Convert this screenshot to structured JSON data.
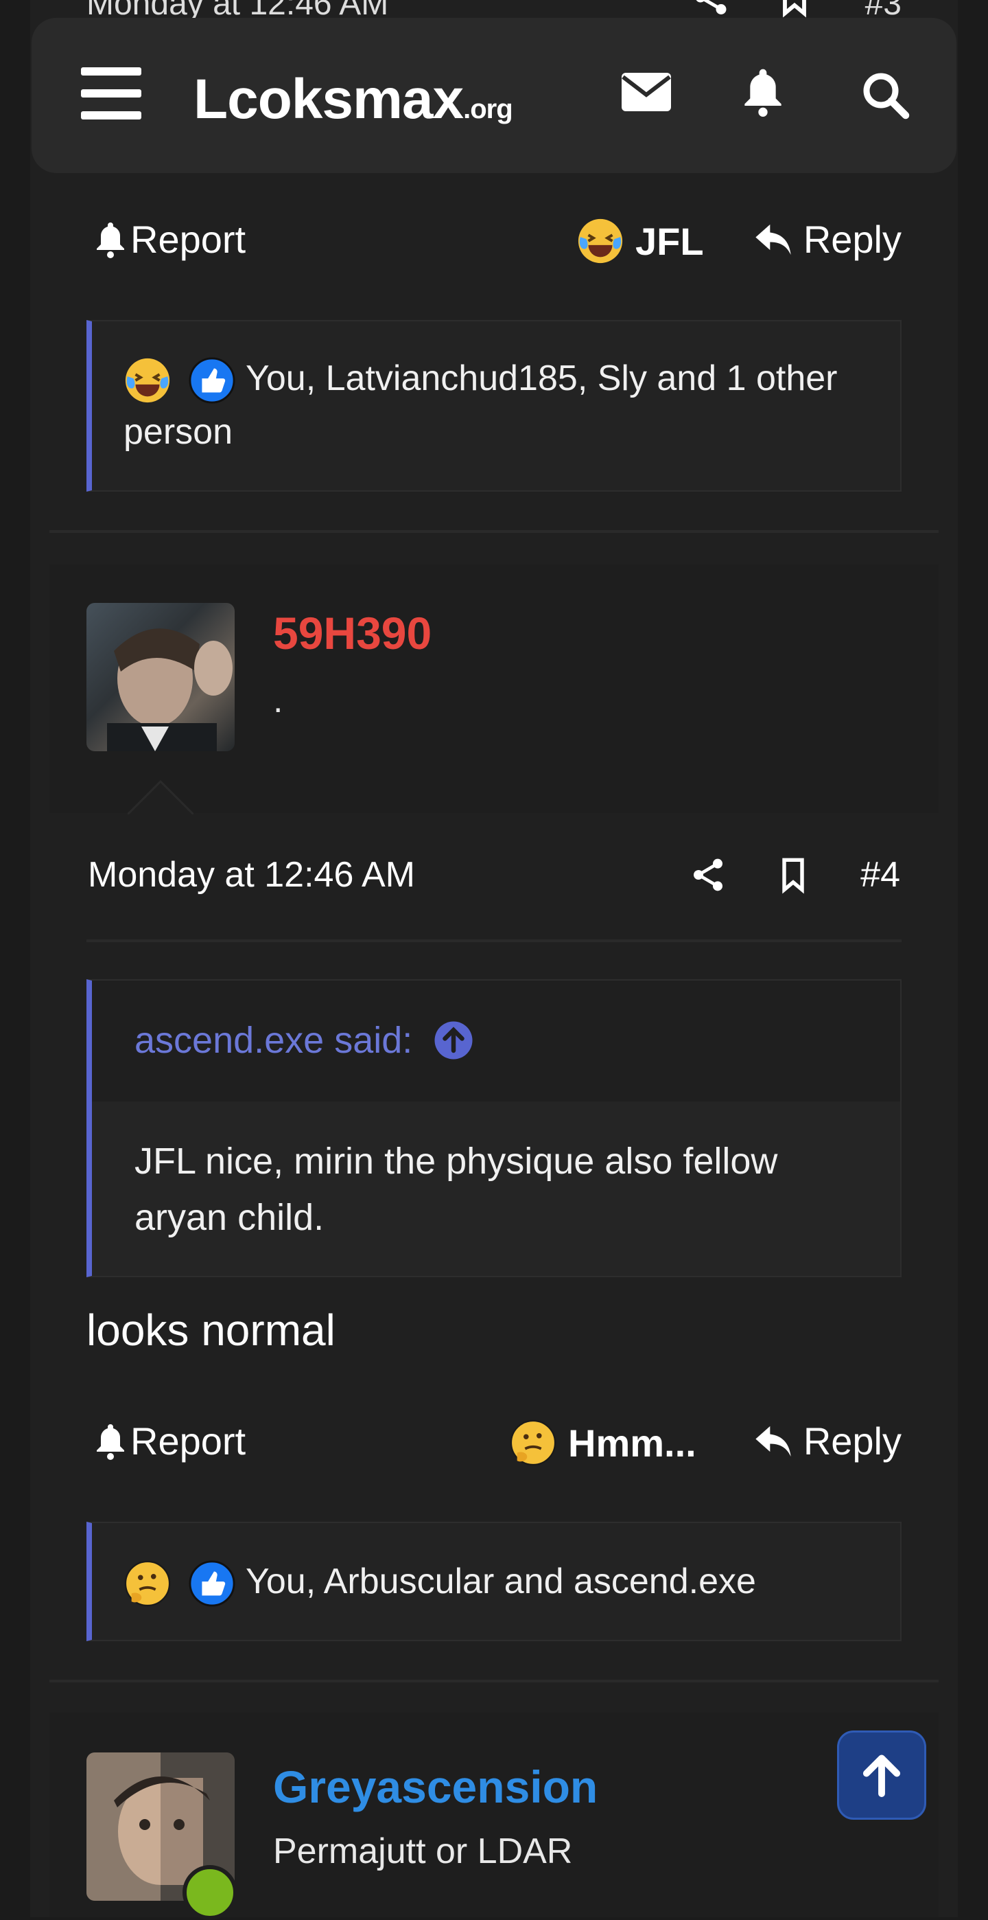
{
  "previous_post": {
    "date": "Monday at 12:46 AM",
    "number": "#3"
  },
  "topbar": {
    "logo_main": "Lcoksmax",
    "logo_suffix": ".org",
    "icons": [
      "menu-icon",
      "mail-icon",
      "bell-icon",
      "search-icon"
    ]
  },
  "post3_actions": {
    "report": "Report",
    "reaction": "JFL",
    "reply": "Reply"
  },
  "post3_reactions": {
    "text": "You, Latvianchud185, Sly and 1 other person"
  },
  "post4": {
    "username": "59H390",
    "username_color": "#e8473f",
    "user_title": ".",
    "date": "Monday at 12:46 AM",
    "number": "#4",
    "quote_author": "ascend.exe said:",
    "quote_text": "JFL nice, mirin the physique also fellow aryan child.",
    "body": "looks normal",
    "actions": {
      "report": "Report",
      "reaction": "Hmm...",
      "reply": "Reply"
    },
    "reactions_text": "You, Arbuscular and ascend.exe"
  },
  "post5": {
    "username": "Greyascension",
    "username_color": "#2f8de4",
    "user_title": "Permajutt or LDAR"
  },
  "colors": {
    "accent": "#5865d0",
    "online": "#7ab81e",
    "scroll_button": "#1e3f86"
  }
}
